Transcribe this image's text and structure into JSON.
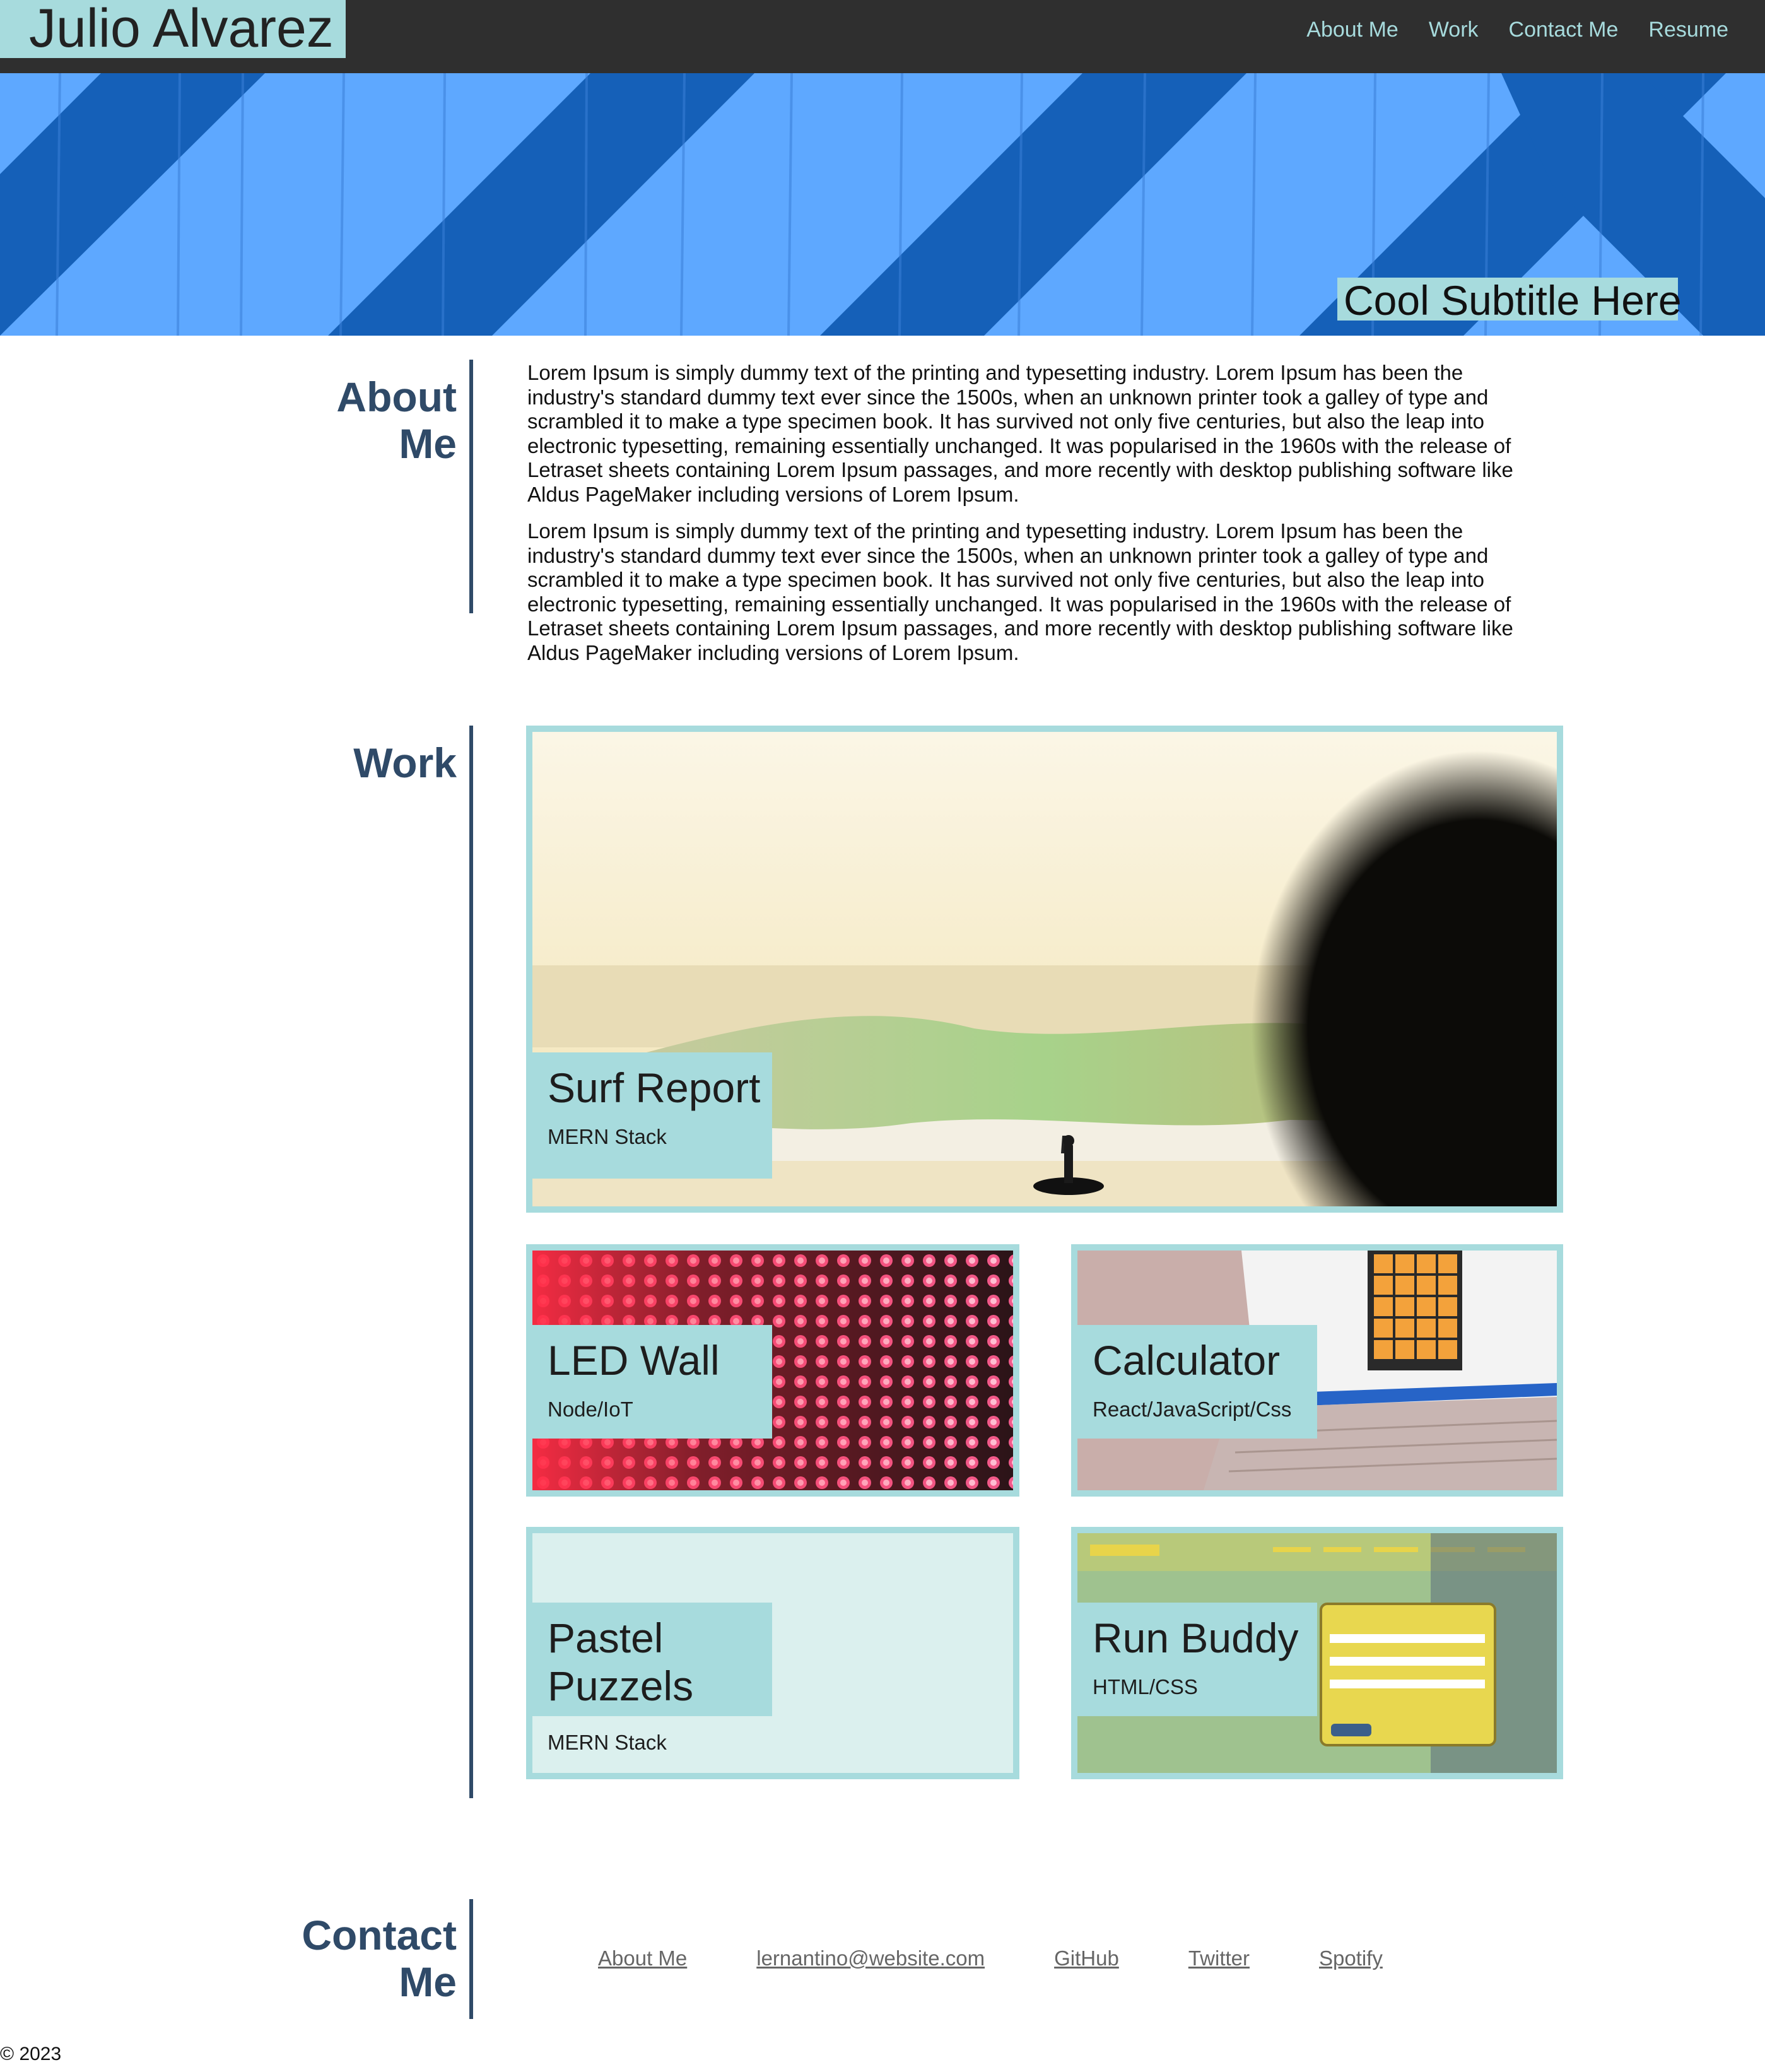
{
  "header": {
    "brand": "Julio Alvarez",
    "nav": [
      "About Me",
      "Work",
      "Contact Me",
      "Resume"
    ]
  },
  "hero": {
    "subtitle": "Cool Subtitle Here"
  },
  "about": {
    "heading": "About Me",
    "paragraphs": [
      "Lorem Ipsum is simply dummy text of the printing and typesetting industry. Lorem Ipsum has been the industry's standard dummy text ever since the 1500s, when an unknown printer took a galley of type and scrambled it to make a type specimen book. It has survived not only five centuries, but also the leap into electronic typesetting, remaining essentially unchanged. It was popularised in the 1960s with the release of Letraset sheets containing Lorem Ipsum passages, and more recently with desktop publishing software like Aldus PageMaker including versions of Lorem Ipsum.",
      "Lorem Ipsum is simply dummy text of the printing and typesetting industry. Lorem Ipsum has been the industry's standard dummy text ever since the 1500s, when an unknown printer took a galley of type and scrambled it to make a type specimen book. It has survived not only five centuries, but also the leap into electronic typesetting, remaining essentially unchanged. It was popularised in the 1960s with the release of Letraset sheets containing Lorem Ipsum passages, and more recently with desktop publishing software like Aldus PageMaker including versions of Lorem Ipsum."
    ]
  },
  "work": {
    "heading": "Work",
    "projects": [
      {
        "title": "Surf Report",
        "stack": "MERN Stack"
      },
      {
        "title": "LED Wall",
        "stack": "Node/IoT"
      },
      {
        "title": "Calculator",
        "stack": "React/JavaScript/Css"
      },
      {
        "title": "Pastel Puzzels",
        "stack": "MERN Stack"
      },
      {
        "title": "Run Buddy",
        "stack": "HTML/CSS"
      }
    ]
  },
  "contact": {
    "heading": "Contact Me",
    "links": [
      "About Me",
      "lernantino@website.com",
      "GitHub",
      "Twitter",
      "Spotify"
    ]
  },
  "footer": {
    "copyright": "© 2023"
  },
  "colors": {
    "header_bg": "#2f2f2f",
    "accent": "#a7dbdd",
    "heading": "#2f4a68",
    "hero_blue": "#5ea8ff"
  }
}
